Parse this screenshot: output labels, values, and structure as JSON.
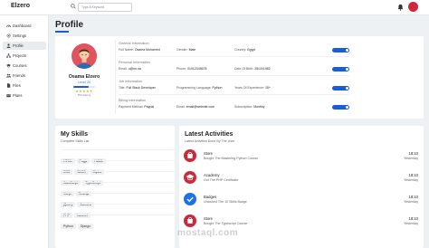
{
  "topbar": {
    "brand": "Elzero",
    "search_placeholder": "Type A Keyword"
  },
  "sidebar": {
    "items": [
      {
        "label": "Dashboard",
        "icon": "gauge-icon"
      },
      {
        "label": "Settings",
        "icon": "gear-icon"
      },
      {
        "label": "Profile",
        "icon": "user-icon",
        "active": true
      },
      {
        "label": "Projects",
        "icon": "diagram-icon"
      },
      {
        "label": "Courses",
        "icon": "graduation-cap-icon"
      },
      {
        "label": "Friends",
        "icon": "users-icon"
      },
      {
        "label": "Files",
        "icon": "file-icon"
      },
      {
        "label": "Plans",
        "icon": "credit-card-icon"
      }
    ]
  },
  "page": {
    "title": "Profile"
  },
  "profile": {
    "name": "Osama Elzero",
    "level": "Level 20",
    "level_progress": 0.7,
    "stars": "★★★★★",
    "rating": "550 Rating",
    "general": {
      "title": "General Information",
      "full_name_label": "Full Name:",
      "full_name": "Osama Mohamed",
      "gender_label": "Gender:",
      "gender": "Male",
      "country_label": "Country:",
      "country": "Egypt"
    },
    "personal": {
      "title": "Personal Information",
      "email_label": "Email:",
      "email": "o@nn.sa",
      "phone_label": "Phone:",
      "phone": "01012345678",
      "dob_label": "Date Of Birth:",
      "dob": "25/10/1982"
    },
    "job": {
      "title": "Job Information",
      "title_label": "Title:",
      "title_value": "Full Stack Developer",
      "lang_label": "Programming Language:",
      "lang": "Python",
      "years_label": "Years Of Experience:",
      "years": "15+"
    },
    "billing": {
      "title": "Billing Information",
      "method_label": "Payment Method:",
      "method": "Paypal",
      "email_label": "Email:",
      "email": "email@website.com",
      "sub_label": "Subscription:",
      "sub": "Monthly"
    }
  },
  "skills": {
    "title": "My Skills",
    "subtitle": "Complete Skills List",
    "rows": [
      [
        "HTML",
        "Pugjs",
        "HAML"
      ],
      [
        "CSS",
        "SASS",
        "Stylus"
      ],
      [
        "JavaScript",
        "TypeScript"
      ],
      [
        "Vuejs",
        "Reactjs"
      ],
      [
        "jQuery",
        "Jasmine"
      ],
      [
        "PHP",
        "Laravel"
      ],
      [
        "Python",
        "Django"
      ]
    ]
  },
  "activities": {
    "title": "Latest Activities",
    "subtitle": "Latest Activities Done By The User",
    "items": [
      {
        "title": "Store",
        "desc": "Bought The Mastering Python Course",
        "time": "18:10",
        "date": "Yesterday",
        "icon": "store-icon",
        "color": "#cc2a3b"
      },
      {
        "title": "Academy",
        "desc": "Got The PHP Certificate",
        "time": "18:10",
        "date": "Yesterday",
        "icon": "graduation-cap-icon",
        "color": "#cc2a3b"
      },
      {
        "title": "Badges",
        "desc": "Unlocked The 10 Skills Badge",
        "time": "18:10",
        "date": "Yesterday",
        "icon": "check-badge-icon",
        "color": "#1b73e8"
      },
      {
        "title": "Store",
        "desc": "Bought The Typescript Course",
        "time": "18:10",
        "date": "Yesterday",
        "icon": "store-icon",
        "color": "#cc2a3b"
      }
    ]
  },
  "watermark": "mostaql.com",
  "colors": {
    "accent": "#1b5cd8",
    "red": "#cc2a3b",
    "sidebar_active": "#e9ecef"
  }
}
